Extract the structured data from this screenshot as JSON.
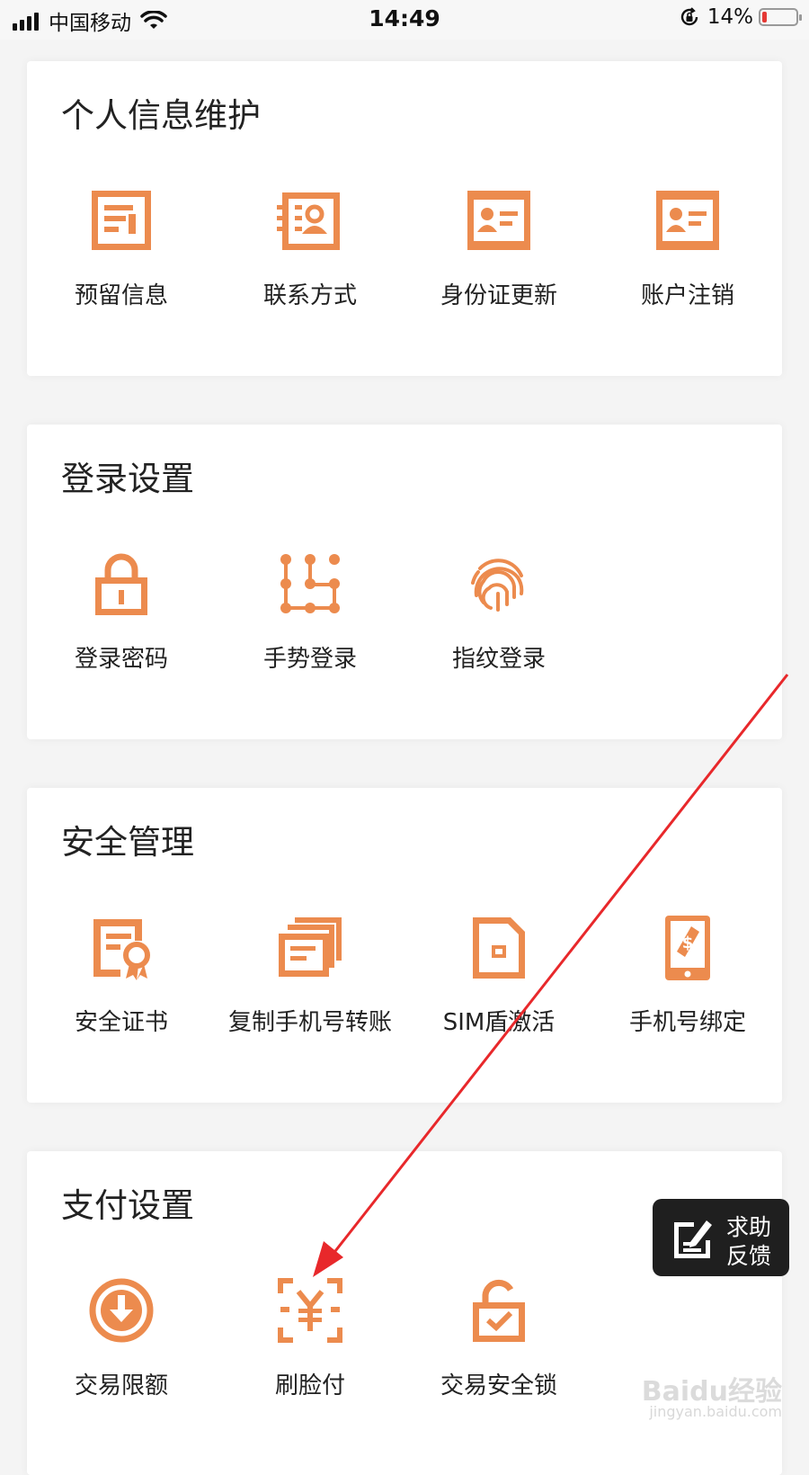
{
  "status_bar": {
    "carrier": "中国移动",
    "time": "14:49",
    "battery_percent": "14%",
    "battery_level": 0.14
  },
  "sections": [
    {
      "title": "个人信息维护",
      "items": [
        {
          "label": "预留信息",
          "icon": "document-icon"
        },
        {
          "label": "联系方式",
          "icon": "contact-card-icon"
        },
        {
          "label": "身份证更新",
          "icon": "id-card-icon"
        },
        {
          "label": "账户注销",
          "icon": "id-card-icon"
        }
      ]
    },
    {
      "title": "登录设置",
      "items": [
        {
          "label": "登录密码",
          "icon": "lock-icon"
        },
        {
          "label": "手势登录",
          "icon": "gesture-grid-icon"
        },
        {
          "label": "指纹登录",
          "icon": "fingerprint-icon"
        }
      ]
    },
    {
      "title": "安全管理",
      "items": [
        {
          "label": "安全证书",
          "icon": "certificate-icon"
        },
        {
          "label": "复制手机号转账",
          "icon": "copy-cards-icon"
        },
        {
          "label": "SIM盾激活",
          "icon": "sim-card-icon"
        },
        {
          "label": "手机号绑定",
          "icon": "phone-bind-icon"
        }
      ]
    },
    {
      "title": "支付设置",
      "items": [
        {
          "label": "交易限额",
          "icon": "download-circle-icon"
        },
        {
          "label": "刷脸付",
          "icon": "face-pay-icon"
        },
        {
          "label": "交易安全锁",
          "icon": "check-lock-icon"
        }
      ]
    }
  ],
  "help_button": {
    "line1": "求助",
    "line2": "反馈"
  },
  "colors": {
    "accent": "#ec8b4e",
    "background": "#f4f4f4",
    "annotation_arrow": "#e8282b"
  },
  "watermark": {
    "brand": "Baidu经验",
    "url": "jingyan.baidu.com"
  }
}
